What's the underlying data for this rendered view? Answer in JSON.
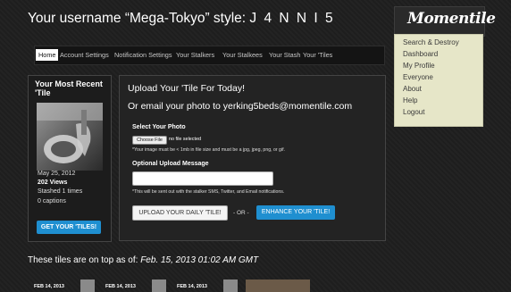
{
  "page": {
    "title_prefix": "Your username “Mega-Tokyo” style:",
    "style_value": "J 4 N N I 5"
  },
  "logo": {
    "text": "Momentile"
  },
  "side_menu": [
    "Search & Destroy",
    "Dashboard",
    "My Profile",
    "Everyone",
    "About",
    "Help",
    "Logout"
  ],
  "nav_tabs": [
    "Home",
    "Account Settings",
    "Notification Settings",
    "Your Stalkers",
    "Your Stalkees",
    "Your Stash",
    "Your 'Tiles"
  ],
  "recent": {
    "title": "Your Most Recent 'Tile",
    "date": "May 25, 2012",
    "views": "202 Views",
    "stashed": "Stashed 1 times",
    "captions": "0 captions",
    "button": "GET YOUR 'TILES!"
  },
  "upload": {
    "heading1": "Upload Your 'Tile For Today!",
    "heading2": "Or email your photo to yerking5beds@momentile.com",
    "photo_label": "Select Your Photo",
    "choose_file": "Choose File",
    "no_file": "no file selected",
    "photo_help": "*Your image must be < 1mb in file size and must be a jpg, jpeg, png, or gif.",
    "caption_label": "Optional Upload Message",
    "caption_value": "",
    "caption_help": "*This will be sent out with the stalker SMS, Twitter, and Email notifications.",
    "upload_button": "UPLOAD YOUR DAILY 'TILE!",
    "or_text": "- OR -",
    "enhance_button": "ENHANCE YOUR 'TILE!"
  },
  "top_tiles": {
    "heading_prefix": "These tiles are on top as of:",
    "heading_date": "Feb. 15, 2013 01:02 AM GMT",
    "tiles": [
      {
        "date": "FEB 14, 2013"
      },
      {
        "date": "FEB 14, 2013"
      },
      {
        "date": "FEB 14, 2013"
      }
    ]
  },
  "colors": {
    "accent_blue": "#1f8fd0",
    "menu_bg": "#e6e6c8",
    "page_bg": "#1f1f1f"
  }
}
